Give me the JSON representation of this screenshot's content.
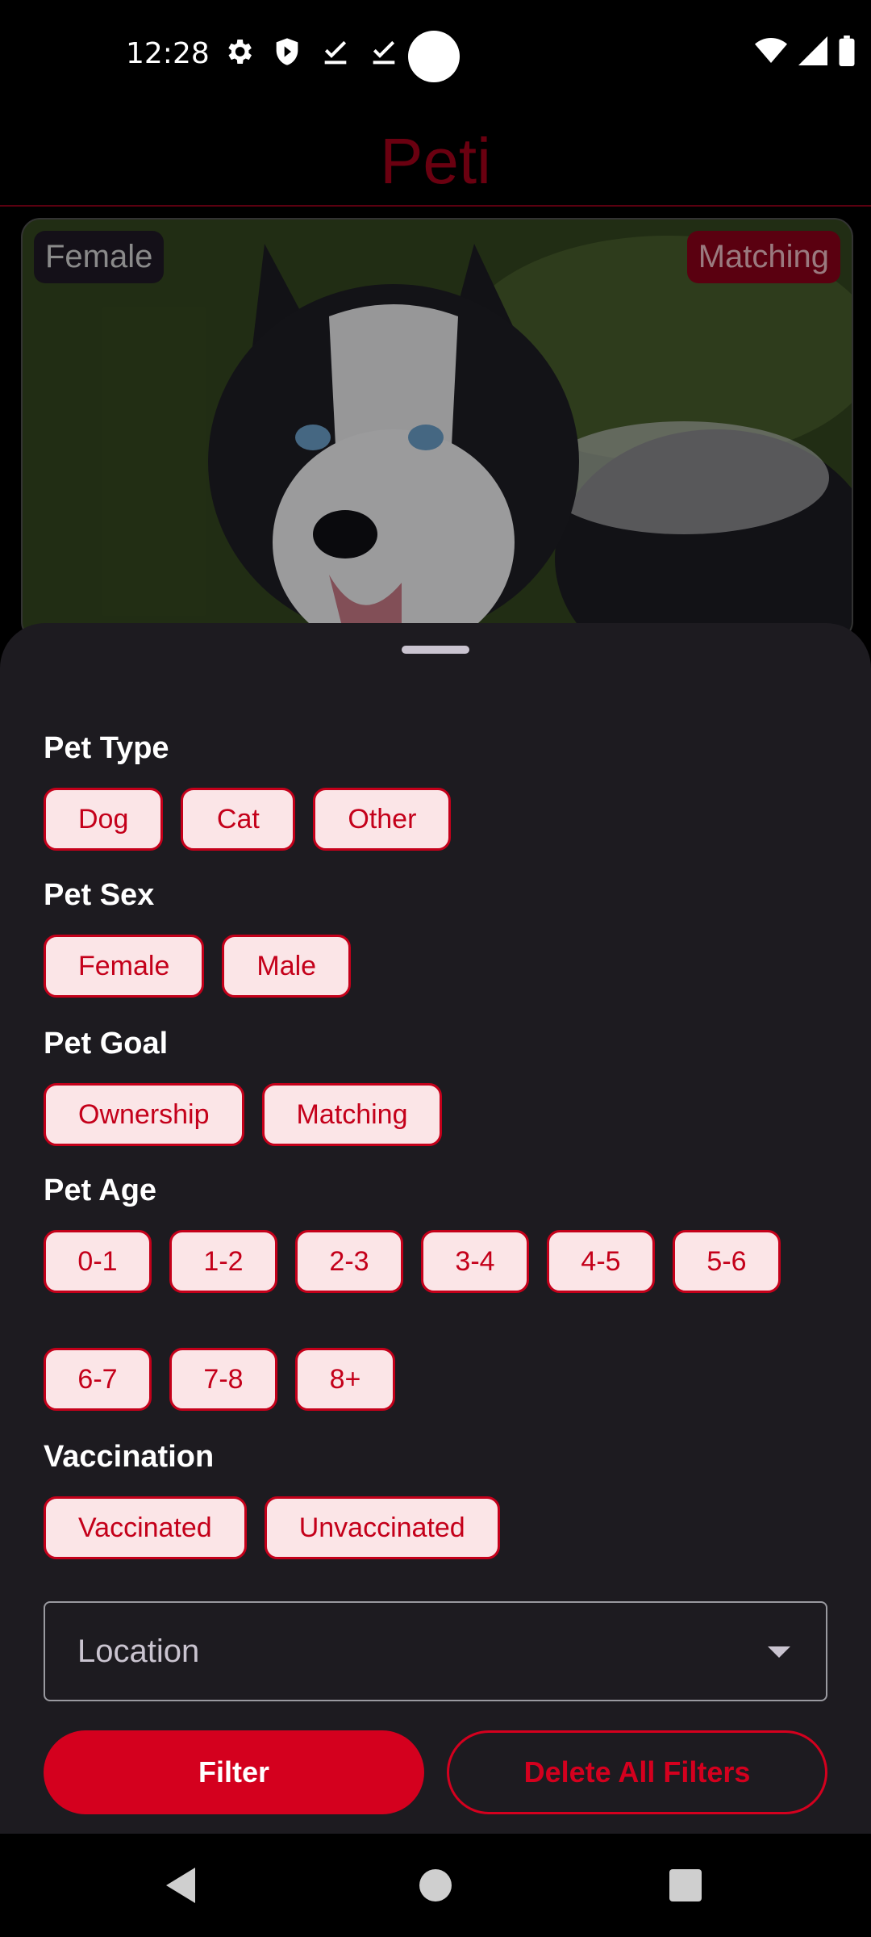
{
  "status_bar": {
    "time": "12:28"
  },
  "app": {
    "title": "Peti"
  },
  "card": {
    "badge_left": "Female",
    "badge_right": "Matching"
  },
  "filters": {
    "pet_type": {
      "title": "Pet Type",
      "options": [
        "Dog",
        "Cat",
        "Other"
      ]
    },
    "pet_sex": {
      "title": "Pet Sex",
      "options": [
        "Female",
        "Male"
      ]
    },
    "pet_goal": {
      "title": "Pet Goal",
      "options": [
        "Ownership",
        "Matching"
      ]
    },
    "pet_age": {
      "title": "Pet Age",
      "options": [
        "0-1",
        "1-2",
        "2-3",
        "3-4",
        "4-5",
        "5-6",
        "6-7",
        "7-8",
        "8+"
      ]
    },
    "vaccination": {
      "title": "Vaccination",
      "options": [
        "Vaccinated",
        "Unvaccinated"
      ]
    }
  },
  "location": {
    "label": "Location"
  },
  "buttons": {
    "filter": "Filter",
    "delete_all": "Delete All Filters"
  },
  "colors": {
    "accent": "#d4001e",
    "chip_bg": "#fbe5e7",
    "sheet_bg": "#1d1b20"
  }
}
